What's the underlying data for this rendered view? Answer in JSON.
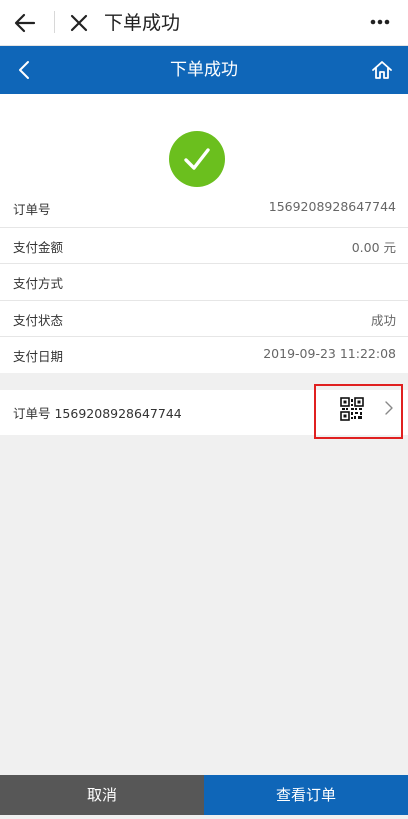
{
  "webview": {
    "title": "下单成功"
  },
  "header": {
    "title": "下单成功"
  },
  "details": [
    {
      "key": "订单号",
      "value": "1569208928647744"
    },
    {
      "key": "支付金额",
      "value": "0.00 元"
    },
    {
      "key": "支付方式",
      "value": ""
    },
    {
      "key": "支付状态",
      "value": "成功"
    },
    {
      "key": "支付日期",
      "value": "2019-09-23 11:22:08"
    }
  ],
  "order_qr": {
    "label": "订单号 1569208928647744"
  },
  "buttons": {
    "cancel": "取消",
    "view_order": "查看订单"
  },
  "colors": {
    "brand_blue": "#0f66b8",
    "success_green": "#6bbf1e",
    "cancel_gray": "#575757",
    "highlight_red": "#e02020"
  },
  "icons": [
    "back-arrow-icon",
    "close-icon",
    "more-icon",
    "chevron-left-icon",
    "home-icon",
    "checkmark-icon",
    "qr-code-icon",
    "chevron-right-icon"
  ]
}
